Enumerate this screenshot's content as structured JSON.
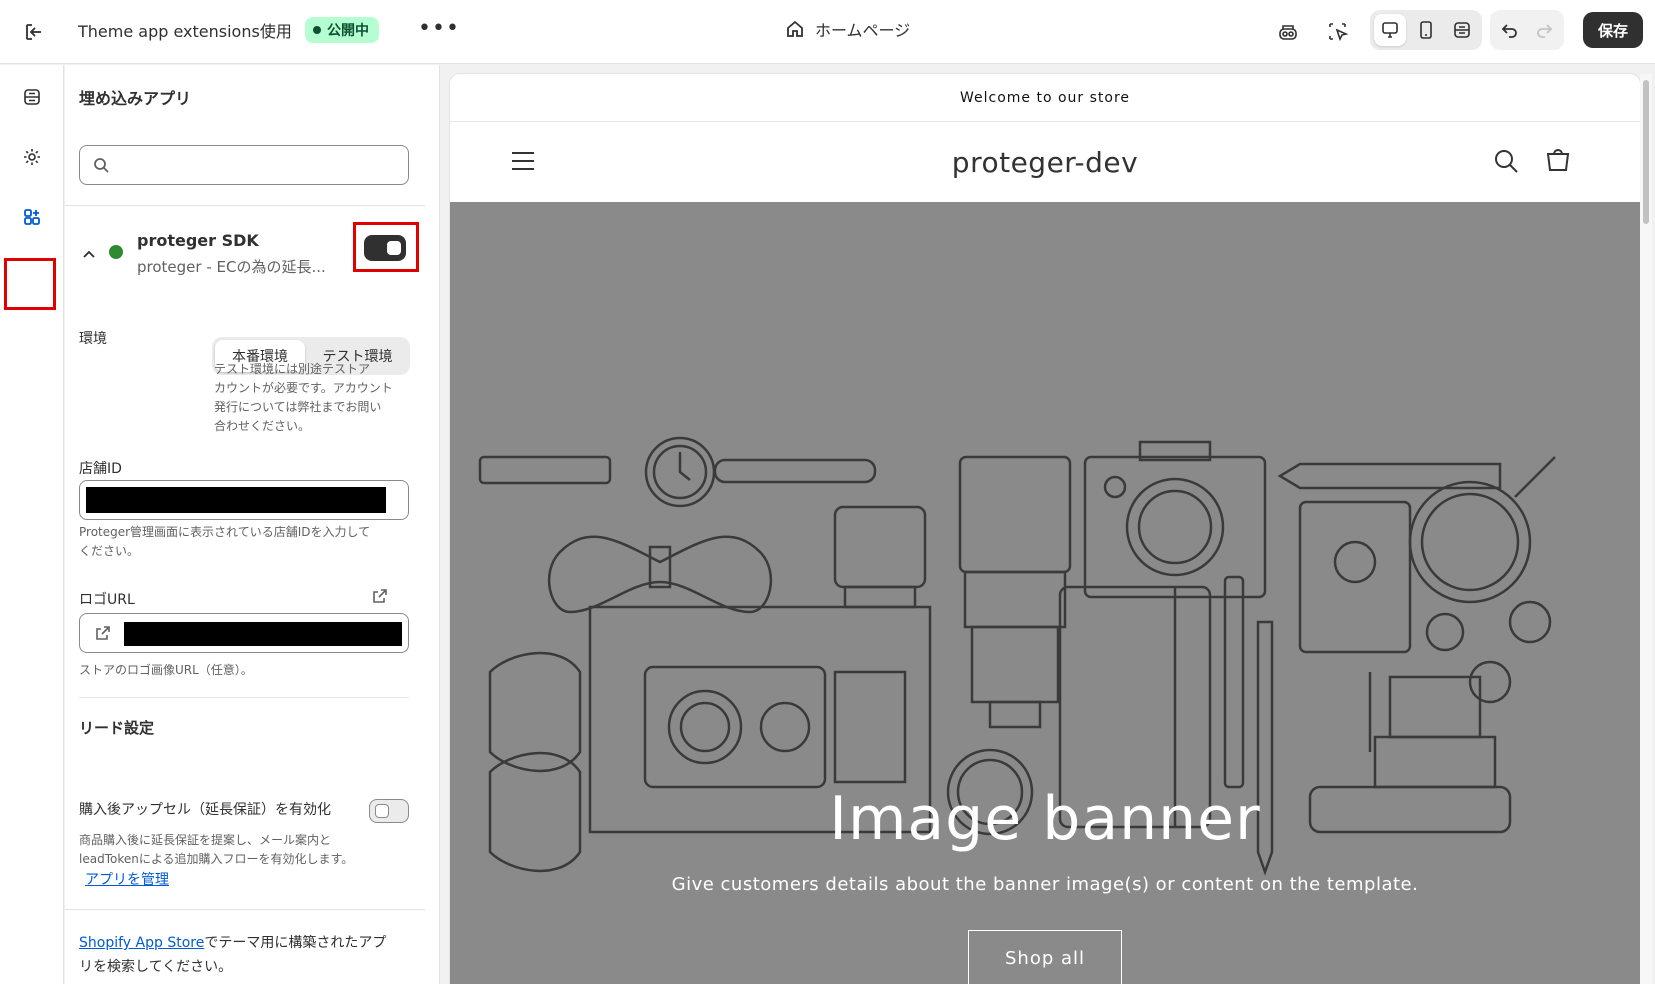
{
  "topbar": {
    "theme_name": "Theme app extensions使用",
    "status_badge": "公開中",
    "more": "•••",
    "page_selector": "ホームページ",
    "save_label": "保存",
    "icons": [
      "exit-icon",
      "home-icon",
      "inspector-icon",
      "select-element-icon",
      "desktop-view-icon",
      "mobile-view-icon",
      "fullscreen-view-icon",
      "undo-icon",
      "redo-icon"
    ]
  },
  "rail": {
    "icons": [
      "sections-icon",
      "settings-gear-icon",
      "apps-icon"
    ],
    "active": "apps-icon"
  },
  "panel": {
    "title": "埋め込みアプリ",
    "search_placeholder": "",
    "app": {
      "name": "proteger SDK",
      "description": "proteger - ECの為の延長...",
      "enabled": true
    },
    "environment": {
      "label": "環境",
      "options": [
        "本番環境",
        "テスト環境"
      ],
      "selected": "本番環境",
      "help_lines": [
        "テスト環境には別途テストア",
        "カウントが必要です。アカウント",
        "発行については弊社までお問い",
        "合わせください。"
      ]
    },
    "store_id": {
      "label": "店舗ID",
      "help_lines": [
        "Proteger管理画面に表示されている店舗IDを入力して",
        "ください。"
      ]
    },
    "logo_url": {
      "label": "ロゴURL",
      "help": "ストアのロゴ画像URL（任意）。"
    },
    "lead": {
      "section_title": "リード設定",
      "upsell_label": "購入後アップセル（延長保証）を有効化",
      "upsell_enabled": false,
      "help_lines": [
        "商品購入後に延長保証を提案し、メール案内と",
        "leadTokenによる追加購入フローを有効化します。"
      ],
      "manage_link": "アプリを管理"
    },
    "footer": {
      "link": "Shopify App Store",
      "text_1": "でテーマ用に構築されたアプ",
      "text_2": "リを検索してください。"
    }
  },
  "preview": {
    "announcement": "Welcome to our store",
    "store_name": "proteger-dev",
    "banner_title": "Image banner",
    "banner_subtitle": "Give customers details about the banner image(s) or content on the template.",
    "banner_button": "Shop all"
  },
  "colors": {
    "accent_dark": "#303030",
    "badge_bg": "#b4fed2",
    "badge_text": "#0c5132",
    "highlight_red": "#e10000",
    "link": "#005bd3",
    "banner_bg": "#8a8a8a"
  }
}
